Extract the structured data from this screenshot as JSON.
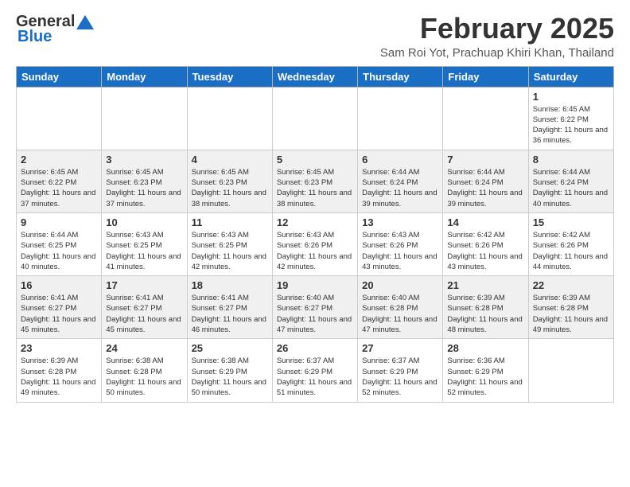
{
  "header": {
    "logo_general": "General",
    "logo_blue": "Blue",
    "month_title": "February 2025",
    "location": "Sam Roi Yot, Prachuap Khiri Khan, Thailand"
  },
  "weekdays": [
    "Sunday",
    "Monday",
    "Tuesday",
    "Wednesday",
    "Thursday",
    "Friday",
    "Saturday"
  ],
  "weeks": [
    [
      {
        "day": "",
        "info": ""
      },
      {
        "day": "",
        "info": ""
      },
      {
        "day": "",
        "info": ""
      },
      {
        "day": "",
        "info": ""
      },
      {
        "day": "",
        "info": ""
      },
      {
        "day": "",
        "info": ""
      },
      {
        "day": "1",
        "info": "Sunrise: 6:45 AM\nSunset: 6:22 PM\nDaylight: 11 hours\nand 36 minutes."
      }
    ],
    [
      {
        "day": "2",
        "info": "Sunrise: 6:45 AM\nSunset: 6:22 PM\nDaylight: 11 hours\nand 37 minutes."
      },
      {
        "day": "3",
        "info": "Sunrise: 6:45 AM\nSunset: 6:23 PM\nDaylight: 11 hours\nand 37 minutes."
      },
      {
        "day": "4",
        "info": "Sunrise: 6:45 AM\nSunset: 6:23 PM\nDaylight: 11 hours\nand 38 minutes."
      },
      {
        "day": "5",
        "info": "Sunrise: 6:45 AM\nSunset: 6:23 PM\nDaylight: 11 hours\nand 38 minutes."
      },
      {
        "day": "6",
        "info": "Sunrise: 6:44 AM\nSunset: 6:24 PM\nDaylight: 11 hours\nand 39 minutes."
      },
      {
        "day": "7",
        "info": "Sunrise: 6:44 AM\nSunset: 6:24 PM\nDaylight: 11 hours\nand 39 minutes."
      },
      {
        "day": "8",
        "info": "Sunrise: 6:44 AM\nSunset: 6:24 PM\nDaylight: 11 hours\nand 40 minutes."
      }
    ],
    [
      {
        "day": "9",
        "info": "Sunrise: 6:44 AM\nSunset: 6:25 PM\nDaylight: 11 hours\nand 40 minutes."
      },
      {
        "day": "10",
        "info": "Sunrise: 6:43 AM\nSunset: 6:25 PM\nDaylight: 11 hours\nand 41 minutes."
      },
      {
        "day": "11",
        "info": "Sunrise: 6:43 AM\nSunset: 6:25 PM\nDaylight: 11 hours\nand 42 minutes."
      },
      {
        "day": "12",
        "info": "Sunrise: 6:43 AM\nSunset: 6:26 PM\nDaylight: 11 hours\nand 42 minutes."
      },
      {
        "day": "13",
        "info": "Sunrise: 6:43 AM\nSunset: 6:26 PM\nDaylight: 11 hours\nand 43 minutes."
      },
      {
        "day": "14",
        "info": "Sunrise: 6:42 AM\nSunset: 6:26 PM\nDaylight: 11 hours\nand 43 minutes."
      },
      {
        "day": "15",
        "info": "Sunrise: 6:42 AM\nSunset: 6:26 PM\nDaylight: 11 hours\nand 44 minutes."
      }
    ],
    [
      {
        "day": "16",
        "info": "Sunrise: 6:41 AM\nSunset: 6:27 PM\nDaylight: 11 hours\nand 45 minutes."
      },
      {
        "day": "17",
        "info": "Sunrise: 6:41 AM\nSunset: 6:27 PM\nDaylight: 11 hours\nand 45 minutes."
      },
      {
        "day": "18",
        "info": "Sunrise: 6:41 AM\nSunset: 6:27 PM\nDaylight: 11 hours\nand 46 minutes."
      },
      {
        "day": "19",
        "info": "Sunrise: 6:40 AM\nSunset: 6:27 PM\nDaylight: 11 hours\nand 47 minutes."
      },
      {
        "day": "20",
        "info": "Sunrise: 6:40 AM\nSunset: 6:28 PM\nDaylight: 11 hours\nand 47 minutes."
      },
      {
        "day": "21",
        "info": "Sunrise: 6:39 AM\nSunset: 6:28 PM\nDaylight: 11 hours\nand 48 minutes."
      },
      {
        "day": "22",
        "info": "Sunrise: 6:39 AM\nSunset: 6:28 PM\nDaylight: 11 hours\nand 49 minutes."
      }
    ],
    [
      {
        "day": "23",
        "info": "Sunrise: 6:39 AM\nSunset: 6:28 PM\nDaylight: 11 hours\nand 49 minutes."
      },
      {
        "day": "24",
        "info": "Sunrise: 6:38 AM\nSunset: 6:28 PM\nDaylight: 11 hours\nand 50 minutes."
      },
      {
        "day": "25",
        "info": "Sunrise: 6:38 AM\nSunset: 6:29 PM\nDaylight: 11 hours\nand 50 minutes."
      },
      {
        "day": "26",
        "info": "Sunrise: 6:37 AM\nSunset: 6:29 PM\nDaylight: 11 hours\nand 51 minutes."
      },
      {
        "day": "27",
        "info": "Sunrise: 6:37 AM\nSunset: 6:29 PM\nDaylight: 11 hours\nand 52 minutes."
      },
      {
        "day": "28",
        "info": "Sunrise: 6:36 AM\nSunset: 6:29 PM\nDaylight: 11 hours\nand 52 minutes."
      },
      {
        "day": "",
        "info": ""
      }
    ]
  ]
}
